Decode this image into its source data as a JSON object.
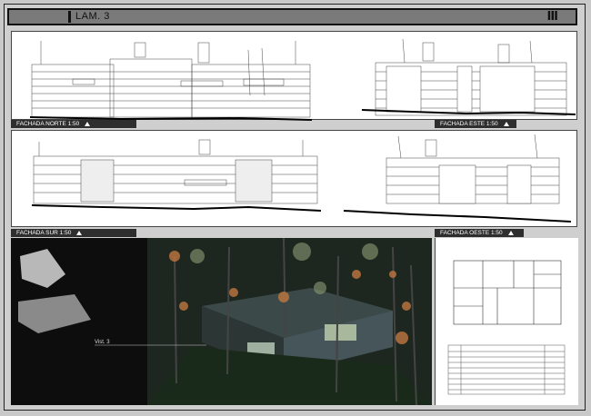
{
  "sheet": {
    "title": "LAM. 3",
    "number": "III"
  },
  "elevations": [
    {
      "id": "norte",
      "caption": "FACHADA NORTE 1:50"
    },
    {
      "id": "este",
      "caption": "FACHADA ESTE 1:50"
    },
    {
      "id": "sur",
      "caption": "FACHADA SUR 1:50"
    },
    {
      "id": "oeste",
      "caption": "FACHADA OESTE 1:50"
    }
  ],
  "render": {
    "view_label": "Vist. 3"
  },
  "colors": {
    "frame": "#111111",
    "title_bg": "#7a7a7a",
    "caption_bg": "#2e2e2e",
    "render_bg": "#111111"
  },
  "icons": [
    "caption-triangle-icon"
  ]
}
